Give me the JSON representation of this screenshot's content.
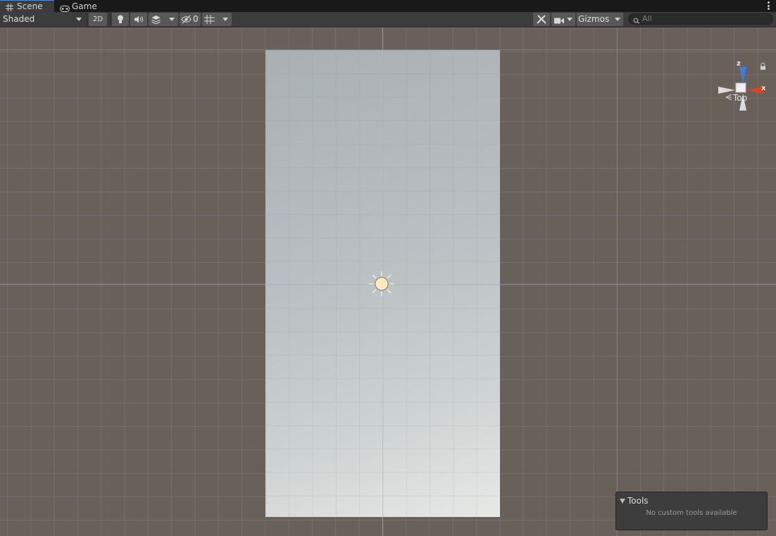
{
  "tabs": [
    {
      "label": "Scene",
      "icon": "grid-icon",
      "active": true
    },
    {
      "label": "Game",
      "icon": "gamepad-icon",
      "active": false
    }
  ],
  "toolbar": {
    "draw_mode": "Shaded",
    "mode_2d": "2D",
    "hidden_count": "0",
    "gizmos_label": "Gizmos",
    "search_placeholder": "All"
  },
  "scene": {
    "view_label": "Top",
    "axis_x": "x",
    "axis_z": "z"
  },
  "tools_overlay": {
    "title": "Tools",
    "message": "No custom tools available"
  },
  "colors": {
    "background": "#6a605a",
    "toolbar": "#3c3c3c",
    "x_axis": "#e0401c",
    "z_axis": "#3c7ae0"
  }
}
